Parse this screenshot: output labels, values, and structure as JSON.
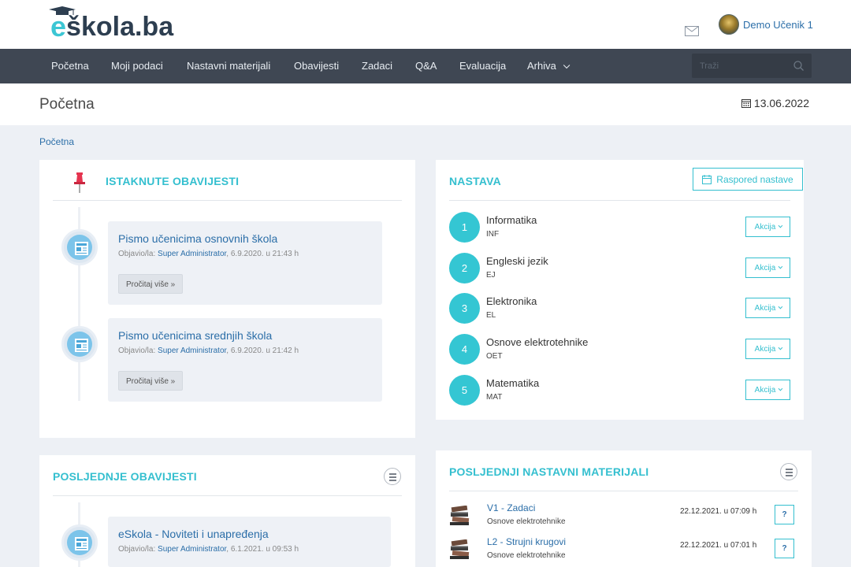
{
  "brand": {
    "logo_e": "e",
    "logo_rest": "škola.ba"
  },
  "header": {
    "user_name": "Demo Učenik 1"
  },
  "nav": {
    "items": [
      "Početna",
      "Moji podaci",
      "Nastavni materijali",
      "Obavijesti",
      "Zadaci",
      "Q&A",
      "Evaluacija",
      "Arhiva"
    ],
    "search_placeholder": "Traži"
  },
  "page": {
    "title": "Početna",
    "date": "13.06.2022",
    "breadcrumb": "Početna"
  },
  "featured": {
    "title": "ISTAKNUTE OBAVIJESTI",
    "posts": [
      {
        "title": "Pismo učenicima osnovnih škola",
        "meta_prefix": "Objavio/la: ",
        "author": "Super Administrator",
        "meta_suffix": ", 6.9.2020. u 21:43 h",
        "button": "Pročitaj više »"
      },
      {
        "title": "Pismo učenicima srednjih škola",
        "meta_prefix": "Objavio/la: ",
        "author": "Super Administrator",
        "meta_suffix": ", 6.9.2020. u 21:42 h",
        "button": "Pročitaj više »"
      }
    ]
  },
  "latest": {
    "title": "POSLJEDNJE OBAVIJESTI",
    "posts": [
      {
        "title": "eSkola - Noviteti i unapređenja",
        "meta_prefix": "Objavio/la: ",
        "author": "Super Administrator",
        "meta_suffix": ", 6.1.2021. u 09:53 h"
      }
    ]
  },
  "nastava": {
    "title": "NASTAVA",
    "schedule_button": "Raspored nastave",
    "action_label": "Akcija",
    "subjects": [
      {
        "num": "1",
        "name": "Informatika",
        "code": "INF"
      },
      {
        "num": "2",
        "name": "Engleski jezik",
        "code": "EJ"
      },
      {
        "num": "3",
        "name": "Elektronika",
        "code": "EL"
      },
      {
        "num": "4",
        "name": "Osnove elektrotehnike",
        "code": "OET"
      },
      {
        "num": "5",
        "name": "Matematika",
        "code": "MAT"
      }
    ]
  },
  "materials": {
    "title": "POSLJEDNJI NASTAVNI MATERIJALI",
    "items": [
      {
        "title": "V1 - Zadaci",
        "subject": "Osnove elektrotehnike",
        "date": "22.12.2021. u 07:09 h",
        "q": "?"
      },
      {
        "title": "L2 - Strujni krugovi",
        "subject": "Osnove elektrotehnike",
        "date": "22.12.2021. u 07:01 h",
        "q": "?"
      }
    ]
  },
  "colors": {
    "accent": "#34bfcf",
    "link": "#2b6ea8",
    "nav_bg": "#3f4753",
    "page_bg": "#edf0f5"
  }
}
